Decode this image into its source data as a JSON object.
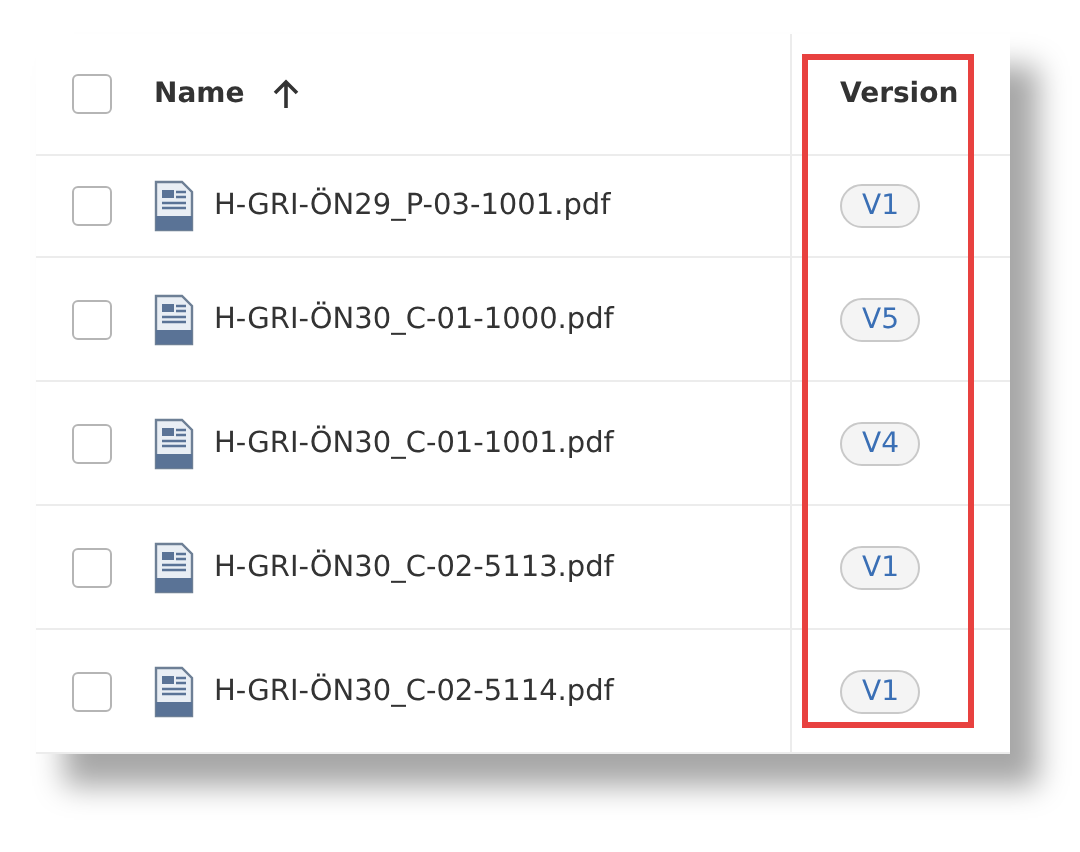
{
  "table": {
    "columns": [
      {
        "label": "Name",
        "sorted_ascending": true
      },
      {
        "label": "Version",
        "highlighted": true
      }
    ],
    "rows": [
      {
        "name": "H-GRI-ÖN29_P-03-1001.pdf",
        "version": "V1",
        "checked": false
      },
      {
        "name": "H-GRI-ÖN30_C-01-1000.pdf",
        "version": "V5",
        "checked": false
      },
      {
        "name": "H-GRI-ÖN30_C-01-1001.pdf",
        "version": "V4",
        "checked": false
      },
      {
        "name": "H-GRI-ÖN30_C-02-5113.pdf",
        "version": "V1",
        "checked": false
      },
      {
        "name": "H-GRI-ÖN30_C-02-5114.pdf",
        "version": "V1",
        "checked": false
      }
    ],
    "all_checked": false
  }
}
